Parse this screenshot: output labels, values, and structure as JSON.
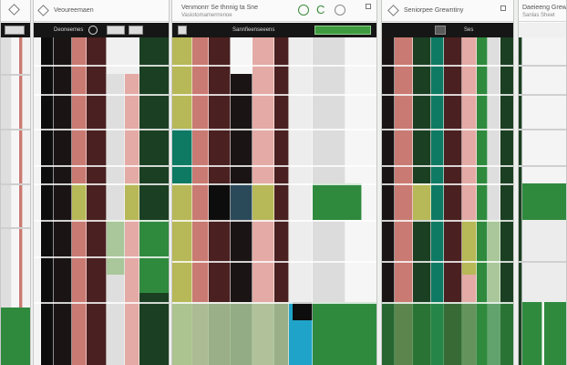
{
  "colors": {
    "dark": "#1a1414",
    "black": "#0d0d0d",
    "maroon": "#4a2020",
    "red": "#c97a72",
    "pink": "#e4aaa5",
    "green": "#2f8a3e",
    "dark_green": "#1b3f22",
    "light_green": "#a9c79a",
    "olive": "#b7b857",
    "teal": "#0e7a64",
    "cyan": "#20a3c9",
    "gray": "#7b7b7b",
    "light": "#dedede",
    "white": "#f6f6f6"
  },
  "panels": [
    {
      "header_title": "",
      "header_sub": "",
      "toolbar_label": ""
    },
    {
      "header_title": "Veoureemaen",
      "header_sub": "",
      "toolbar_label": "Deoneemes"
    },
    {
      "header_title": "Venmonrr Se thnnig ta Sne",
      "header_sub": "Vasiotomamerrrenoe",
      "toolbar_label": "Sannfieenseeens"
    },
    {
      "header_title": "Seniorpee Grewntiny",
      "header_sub": "",
      "toolbar_label": "Ses"
    },
    {
      "header_title": "Daeieeng Grewei",
      "header_sub": "Sanlas Sheet",
      "toolbar_label": ""
    }
  ],
  "icons": {
    "corner": "diamond-icon",
    "refresh": "refresh-icon",
    "check": "checkmark-icon"
  },
  "glyph_text": "C"
}
